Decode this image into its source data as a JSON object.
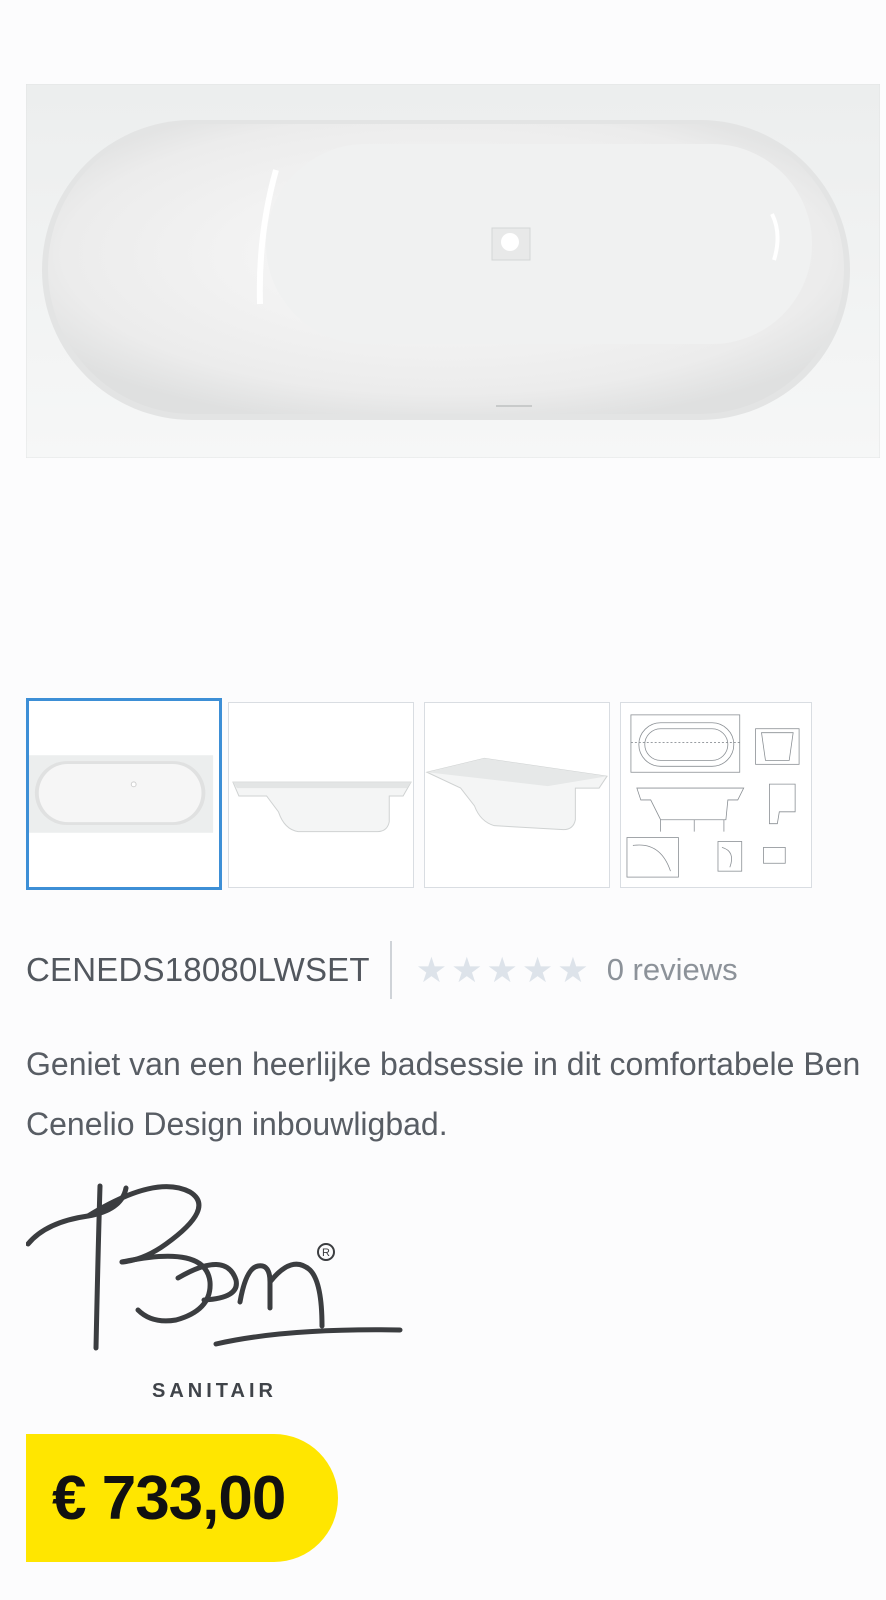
{
  "product": {
    "sku": "CENEDS18080LWSET",
    "rating": {
      "stars_filled": 0,
      "stars_total": 5,
      "reviews_label": "0 reviews"
    },
    "description": "Geniet van een heerlijke badsessie in dit comfortabele Ben Cenelio Design inbouwligbad.",
    "brand": {
      "logo_text": "Ben",
      "registered_mark": "®",
      "subtitle": "SANITAIR"
    },
    "price": "€ 733,00"
  },
  "gallery": {
    "thumbnails": [
      {
        "name": "top-view",
        "active": true
      },
      {
        "name": "side-view",
        "active": false
      },
      {
        "name": "angled-view",
        "active": false
      },
      {
        "name": "technical-drawing",
        "active": false
      }
    ]
  },
  "colors": {
    "accent_border": "#3d8fd6",
    "price_badge": "#ffe600",
    "star_empty": "#dde3ea"
  }
}
